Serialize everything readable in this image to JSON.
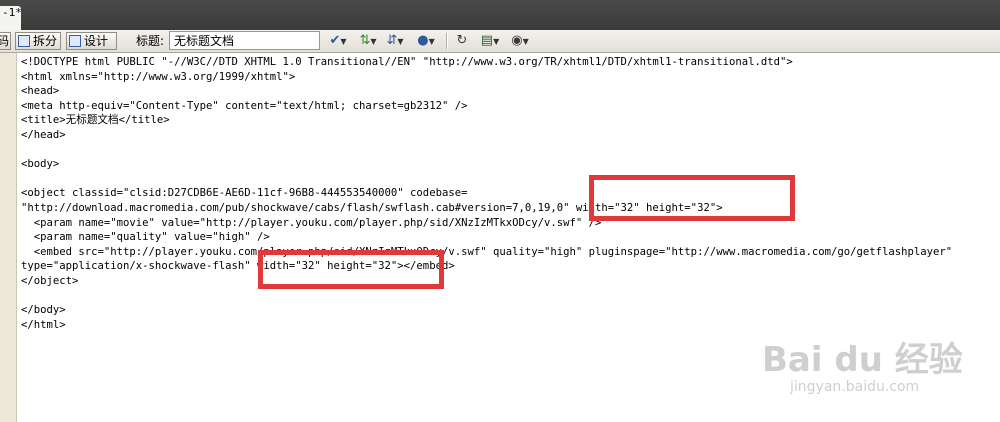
{
  "tab": {
    "label": "-1*"
  },
  "toolbar": {
    "code_label": "码",
    "split_label": "拆分",
    "design_label": "设计",
    "title_label": "标题:",
    "title_value": "无标题文档"
  },
  "code_lines": [
    "<!DOCTYPE html PUBLIC \"-//W3C//DTD XHTML 1.0 Transitional//EN\" \"http://www.w3.org/TR/xhtml1/DTD/xhtml1-transitional.dtd\">",
    "<html xmlns=\"http://www.w3.org/1999/xhtml\">",
    "<head>",
    "<meta http-equiv=\"Content-Type\" content=\"text/html; charset=gb2312\" />",
    "<title>无标题文档</title>",
    "</head>",
    "",
    "<body>",
    "",
    "<object classid=\"clsid:D27CDB6E-AE6D-11cf-96B8-444553540000\" codebase=",
    "\"http://download.macromedia.com/pub/shockwave/cabs/flash/swflash.cab#version=7,0,19,0\" width=\"32\" height=\"32\">",
    "  <param name=\"movie\" value=\"http://player.youku.com/player.php/sid/XNzIzMTkxODcy/v.swf\" />",
    "  <param name=\"quality\" value=\"high\" />",
    "  <embed src=\"http://player.youku.com/player.php/sid/XNzIzMTkxODcy/v.swf\" quality=\"high\" pluginspage=\"http://www.macromedia.com/go/getflashplayer\"",
    "type=\"application/x-shockwave-flash\" width=\"32\" height=\"32\"></embed>",
    "</object>",
    "",
    "</body>",
    "</html>"
  ],
  "watermark": {
    "logo": "Bai du 经验",
    "url": "jingyan.baidu.com"
  },
  "colors": {
    "highlight": "#e0393b",
    "tab_bar": "#3a3a3a",
    "toolbar": "#ece9d8"
  }
}
